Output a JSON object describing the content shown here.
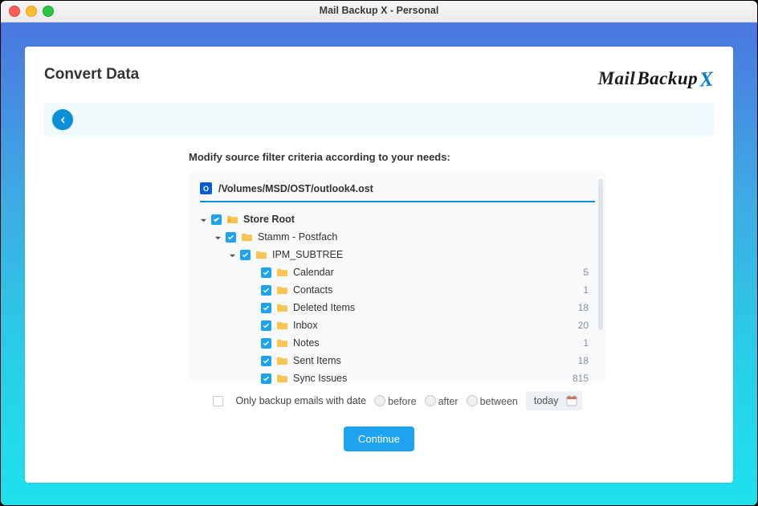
{
  "window_title": "Mail Backup X - Personal",
  "logo": {
    "mail": "Mail",
    "backup": "Backup",
    "x": "X"
  },
  "page_title": "Convert Data",
  "instruction": "Modify source filter criteria according to your needs:",
  "file_path": "/Volumes/MSD/OST/outlook4.ost",
  "tree": {
    "root": {
      "label": "Store Root",
      "checked": true,
      "expanded": true
    },
    "postfach": {
      "label": "Stamm - Postfach",
      "checked": true,
      "expanded": true
    },
    "subtree": {
      "label": "IPM_SUBTREE",
      "checked": true,
      "expanded": true
    },
    "items": [
      {
        "label": "Calendar",
        "checked": true,
        "count": 5
      },
      {
        "label": "Contacts",
        "checked": true,
        "count": 1
      },
      {
        "label": "Deleted Items",
        "checked": true,
        "count": 18
      },
      {
        "label": "Inbox",
        "checked": true,
        "count": 20
      },
      {
        "label": "Notes",
        "checked": true,
        "count": 1
      },
      {
        "label": "Sent Items",
        "checked": true,
        "count": 18
      },
      {
        "label": "Sync Issues",
        "checked": true,
        "count": 815
      }
    ]
  },
  "filter": {
    "checkbox_label": "Only backup emails with date",
    "checked": false,
    "options": {
      "before": "before",
      "after": "after",
      "between": "between"
    },
    "date_value": "today"
  },
  "continue_label": "Continue"
}
